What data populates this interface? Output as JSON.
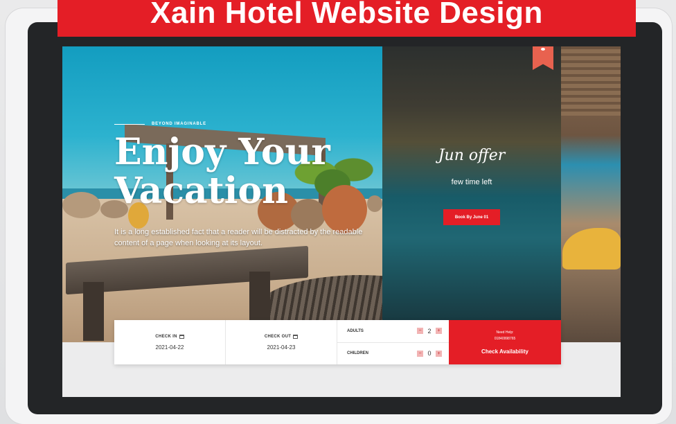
{
  "banner": {
    "title": "Xain Hotel Website Design"
  },
  "hero": {
    "eyebrow": "BEYOND IMAGINABLE",
    "headline_line1": "Enjoy Your",
    "headline_line2": "Vacation",
    "body": "It is a long established fact that a reader will be distracted by the readable content of a page when looking at its layout."
  },
  "offer": {
    "title": "Jun offer",
    "subtitle": "few time left",
    "button": "Book By June 01"
  },
  "booking": {
    "check_in_label": "CHECK IN",
    "check_in_value": "2021-04-22",
    "check_out_label": "CHECK OUT",
    "check_out_value": "2021-04-23",
    "adults_label": "ADULTS",
    "adults_value": "2",
    "children_label": "CHILDREN",
    "children_value": "0",
    "minus": "−",
    "plus": "+",
    "help_label": "Need Help:",
    "help_phone": "01840998765",
    "cta": "Check Availability"
  },
  "colors": {
    "brand_red": "#e41e26",
    "ribbon": "#e8624f",
    "device": "#232527"
  },
  "icons": [
    "calendar-icon",
    "bookmark-ribbon-icon",
    "eye-icon",
    "minus-icon",
    "plus-icon"
  ]
}
